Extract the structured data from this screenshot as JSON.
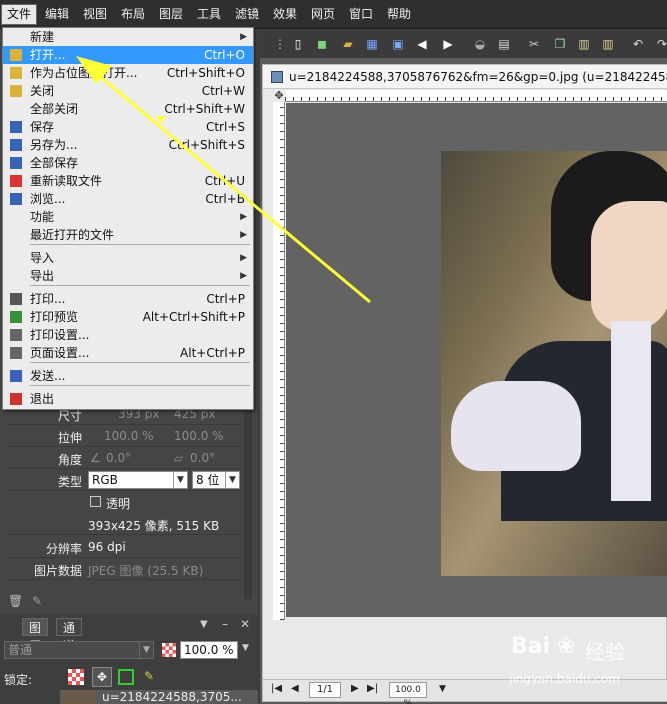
{
  "menubar": {
    "items": [
      "文件",
      "编辑",
      "视图",
      "布局",
      "图层",
      "工具",
      "滤镜",
      "效果",
      "网页",
      "窗口",
      "帮助"
    ]
  },
  "file_menu": {
    "items": [
      {
        "label": "新建",
        "shortcut": "",
        "submenu": true,
        "icon": ""
      },
      {
        "label": "打开...",
        "shortcut": "Ctrl+O",
        "submenu": false,
        "icon": "open-folder-icon"
      },
      {
        "label": "作为占位图层打开...",
        "shortcut": "Ctrl+Shift+O",
        "submenu": false,
        "icon": "open-folder-icon"
      },
      {
        "label": "关闭",
        "shortcut": "Ctrl+W",
        "submenu": false,
        "icon": "close-folder-icon"
      },
      {
        "label": "全部关闭",
        "shortcut": "Ctrl+Shift+W",
        "submenu": false,
        "icon": ""
      },
      {
        "label": "保存",
        "shortcut": "Ctrl+S",
        "submenu": false,
        "icon": "floppy-disk-icon"
      },
      {
        "label": "另存为...",
        "shortcut": "Ctrl+Shift+S",
        "submenu": false,
        "icon": "floppy-disk-icon"
      },
      {
        "label": "全部保存",
        "shortcut": "",
        "submenu": false,
        "icon": "floppy-disk-icon"
      },
      {
        "label": "重新读取文件",
        "shortcut": "Ctrl+U",
        "submenu": false,
        "icon": "reload-icon"
      },
      {
        "label": "浏览...",
        "shortcut": "Ctrl+B",
        "submenu": false,
        "icon": "browse-grid-icon"
      },
      {
        "label": "功能",
        "shortcut": "",
        "submenu": true,
        "icon": ""
      },
      {
        "label": "最近打开的文件",
        "shortcut": "",
        "submenu": true,
        "icon": ""
      },
      {
        "label": "导入",
        "shortcut": "",
        "submenu": true,
        "icon": ""
      },
      {
        "label": "导出",
        "shortcut": "",
        "submenu": true,
        "icon": ""
      },
      {
        "label": "打印...",
        "shortcut": "Ctrl+P",
        "submenu": false,
        "icon": "printer-icon"
      },
      {
        "label": "打印预览",
        "shortcut": "Alt+Ctrl+Shift+P",
        "submenu": false,
        "icon": "print-preview-icon"
      },
      {
        "label": "打印设置...",
        "shortcut": "",
        "submenu": false,
        "icon": "print-setup-icon"
      },
      {
        "label": "页面设置...",
        "shortcut": "Alt+Ctrl+P",
        "submenu": false,
        "icon": "page-setup-icon"
      },
      {
        "label": "发送...",
        "shortcut": "",
        "submenu": false,
        "icon": "email-at-icon"
      },
      {
        "label": "退出",
        "shortcut": "",
        "submenu": false,
        "icon": "exit-door-icon"
      }
    ]
  },
  "properties": {
    "size_label": "尺寸",
    "size_w": "393 px",
    "size_h": "425 px",
    "stretch_label": "拉伸",
    "stretch_w": "100.0 %",
    "stretch_h": "100.0 %",
    "angle_label": "角度",
    "angle_1": "0.0°",
    "angle_2": "0.0°",
    "type_label": "类型",
    "type_value": "RGB",
    "bits_value": "8 位",
    "transparent_label": "透明",
    "pixels_info": "393x425 像素, 515 KB",
    "resolution_label": "分辨率",
    "resolution_value": "96 dpi",
    "image_data_label": "图片数据",
    "image_data_value": "JPEG 图像 (25.5 KB)"
  },
  "layers": {
    "tab_layers": "图层",
    "tab_channels": "通道",
    "blend_mode": "普通",
    "opacity": "100.0 %",
    "lock_label": "锁定:",
    "layer_name": "u=2184224588,3705..."
  },
  "document": {
    "title": "u=2184224588,3705876762&fm=26&gp=0.jpg (u=2184224588,37",
    "page": "1/1",
    "zoom": "100.0 %"
  },
  "watermark": {
    "brand": "Bai",
    "brand_cn": "经验",
    "site": "jingyan.baidu.com"
  },
  "colors": {
    "menu_highlight": "#3399ff",
    "arrow": "#ffff33"
  }
}
